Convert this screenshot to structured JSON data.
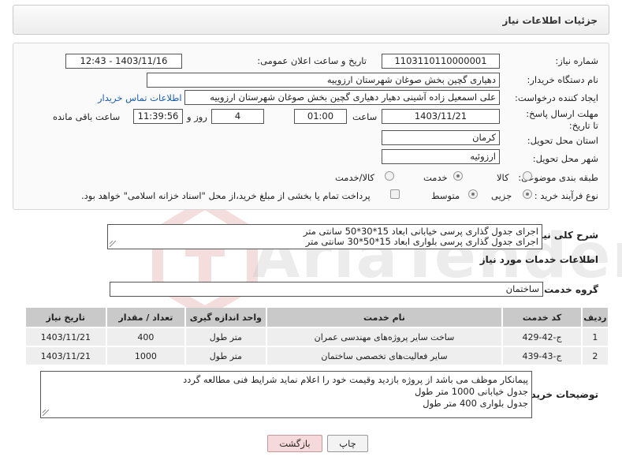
{
  "header": {
    "title": "جزئیات اطلاعات نیاز"
  },
  "form": {
    "need_number": {
      "label": "شماره نیاز:",
      "value": "1103110110000001"
    },
    "announce_date": {
      "label": "تاریخ و ساعت اعلان عمومی:",
      "value": "1403/11/16 - 12:43"
    },
    "buyer_org": {
      "label": "نام دستگاه خریدار:",
      "value": "دهیاری گچین بخش صوغان شهرستان ارزوییه"
    },
    "requester": {
      "label": "ایجاد کننده درخواست:",
      "value": "علی اسمعیل زاده آشینی دهیار دهیاری گچین بخش صوغان شهرستان ارزوییه",
      "link": "اطلاعات تماس خریدار"
    },
    "deadline": {
      "label": "مهلت ارسال پاسخ: تا تاریخ:",
      "date": "1403/11/21",
      "time_label": "ساعت",
      "time": "01:00",
      "days": "4",
      "days_label": "روز و",
      "remaining": "11:39:56",
      "remaining_label": "ساعت باقی مانده"
    },
    "province": {
      "label": "استان محل تحویل:",
      "value": "کرمان"
    },
    "city": {
      "label": "شهر محل تحویل:",
      "value": "ارزوئیه"
    },
    "category": {
      "label": "طبقه بندی موضوعی:",
      "options": [
        "کالا",
        "خدمت",
        "کالا/خدمت"
      ],
      "selected": "خدمت"
    },
    "process": {
      "label": "نوع فرآیند خرید :",
      "options": [
        "جزیی",
        "متوسط"
      ],
      "selected": "جزیی",
      "payment_note": "پرداخت تمام یا بخشی از مبلغ خرید،از محل \"اسناد خزانه اسلامی\" خواهد بود."
    }
  },
  "summary": {
    "label": "شرح کلی نیاز:",
    "lines": [
      "اجرای جدول گذاری پرسی خیابانی ابعاد 15*30*50 سانتی متر",
      "اجرای جدول گذاری پرسی بلواری ابعاد 15*50*30 سانتی متر"
    ]
  },
  "services_section": {
    "title": "اطلاعات خدمات مورد نیاز"
  },
  "service_group": {
    "label": "گروه خدمت:",
    "value": "ساختمان"
  },
  "table": {
    "headers": [
      "ردیف",
      "کد خدمت",
      "نام خدمت",
      "واحد اندازه گیری",
      "تعداد / مقدار",
      "تاریخ نیاز"
    ],
    "rows": [
      [
        "1",
        "ج-42-429",
        "ساخت سایر پروژه‌های مهندسی عمران",
        "متر طول",
        "400",
        "1403/11/21"
      ],
      [
        "2",
        "ج-43-439",
        "سایر فعالیت‌های تخصصی ساختمان",
        "متر طول",
        "1000",
        "1403/11/21"
      ]
    ]
  },
  "buyer_notes": {
    "label": "توضیحات خریدار:",
    "lines": [
      "پیمانکار موظف می باشد از پروژه بازدید وقیمت خود را اعلام نماید شرایط فنی مطالعه گردد",
      "جدول خیابانی 1000 متر طول",
      "جدول بلواری 400 متر طول"
    ]
  },
  "buttons": {
    "back": "بازگشت",
    "print": "چاپ"
  },
  "colors": {
    "link": "#1a5fb4",
    "back_button": "#f6d9da",
    "table_header": "#c9c9c9",
    "table_cell": "#eeeeee"
  }
}
